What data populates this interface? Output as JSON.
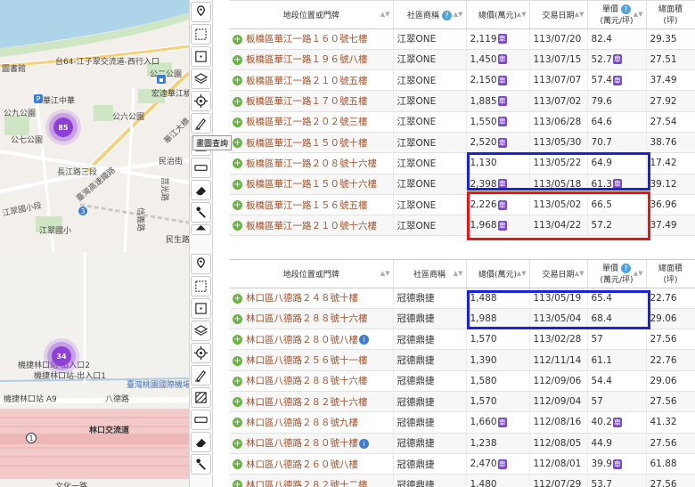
{
  "map_top": {
    "labels": [
      "台64-江子翠交流道-西行入口",
      "圖書館",
      "公二公園",
      "華江中華",
      "宏達華江橋",
      "公六公園",
      "公七公園",
      "公九公園",
      "華江大橋",
      "長江路三段",
      "臺灣高速鐵路",
      "江翠國小",
      "民治街",
      "江翠國小段",
      "莒光路",
      "信義路",
      "國道三號",
      "民生路"
    ],
    "cluster_count": "85"
  },
  "map_bottom": {
    "labels": [
      "機捷林口站-出入口2",
      "機捷林口站-出入口1",
      "機捷林口站 A9",
      "八德路",
      "臺灣桃園國際機場捷運",
      "林口交流道",
      "文化一路"
    ],
    "cluster_count": "34",
    "shield": "1"
  },
  "tools": {
    "icons": [
      "location-pin-icon",
      "select-area-icon",
      "measure-area-icon",
      "layers-icon",
      "target-icon",
      "draw-query-icon",
      "measure-icon",
      "ruler-icon",
      "eraser-icon",
      "pointer-icon",
      "house-icon"
    ],
    "tooltip": "畫圖查詢"
  },
  "table_top": {
    "headers": {
      "address": "地段位置或門牌",
      "community": "社區商稱",
      "total": "總價(萬元)",
      "date": "交易日期",
      "unit_line1": "單價",
      "unit_line2": "(萬元/坪)",
      "area_line1": "總面積",
      "area_line2": "(坪)"
    },
    "badge": "車",
    "rows": [
      {
        "address": "板橋區華江一路１６０號七樓",
        "community": "江翠ONE",
        "total": "2,119",
        "car": true,
        "date": "113/07/20",
        "unit": "82.4",
        "unit_car": false,
        "area": "29.35"
      },
      {
        "address": "板橋區華江一路１９６號八樓",
        "community": "江翠ONE",
        "total": "1,450",
        "car": true,
        "date": "113/07/15",
        "unit": "52.7",
        "unit_car": true,
        "area": "27.51"
      },
      {
        "address": "板橋區華江一路２１０號五樓",
        "community": "江翠ONE",
        "total": "2,150",
        "car": true,
        "date": "113/07/07",
        "unit": "57.4",
        "unit_car": true,
        "area": "37.49"
      },
      {
        "address": "板橋區華江一路１７０號五樓",
        "community": "江翠ONE",
        "total": "1,885",
        "car": true,
        "date": "113/07/02",
        "unit": "79.6",
        "unit_car": false,
        "area": "27.92"
      },
      {
        "address": "板橋區華江一路２０２號三樓",
        "community": "江翠ONE",
        "total": "1,550",
        "car": true,
        "date": "113/06/28",
        "unit": "64.6",
        "unit_car": false,
        "area": "27.54"
      },
      {
        "address": "板橋區華江一路１５０號十樓",
        "community": "江翠ONE",
        "total": "2,520",
        "car": true,
        "date": "113/05/30",
        "unit": "70.7",
        "unit_car": false,
        "area": "38.76"
      },
      {
        "address": "板橋區華江一路２０８號十六樓",
        "community": "江翠ONE",
        "total": "1,130",
        "car": false,
        "date": "113/05/22",
        "unit": "64.9",
        "unit_car": false,
        "area": "17.42"
      },
      {
        "address": "板橋區華江一路１５０號十六樓",
        "community": "江翠ONE",
        "total": "2,398",
        "car": true,
        "date": "113/05/18",
        "unit": "61.3",
        "unit_car": true,
        "area": "39.12"
      },
      {
        "address": "板橋區華江一路１５６號五樓",
        "community": "江翠ONE",
        "total": "2,226",
        "car": true,
        "date": "113/05/02",
        "unit": "66.5",
        "unit_car": false,
        "area": "36.96"
      },
      {
        "address": "板橋區華江一路２１０號十六樓",
        "community": "江翠ONE",
        "total": "1,968",
        "car": true,
        "date": "113/04/22",
        "unit": "57.2",
        "unit_car": false,
        "area": "37.49"
      }
    ]
  },
  "table_bottom": {
    "headers": {
      "address": "地段位置或門牌",
      "community": "社區商稱",
      "total": "總價(萬元)",
      "date": "交易日期",
      "unit_line1": "單價",
      "unit_line2": "(萬元/坪)",
      "area_line1": "總面積",
      "area_line2": "(坪)"
    },
    "badge": "車",
    "rows": [
      {
        "address": "林口區八德路２４８號十樓",
        "info": false,
        "community": "冠德鼎捷",
        "total": "1,488",
        "car": false,
        "date": "113/05/19",
        "unit": "65.4",
        "unit_car": false,
        "area": "22.76"
      },
      {
        "address": "林口區八德路２８８號十六樓",
        "info": false,
        "community": "冠德鼎捷",
        "total": "1,988",
        "car": false,
        "date": "113/05/04",
        "unit": "68.4",
        "unit_car": false,
        "area": "29.06"
      },
      {
        "address": "林口區八德路２８０號八樓",
        "info": true,
        "community": "冠德鼎捷",
        "total": "1,570",
        "car": false,
        "date": "113/02/28",
        "unit": "57",
        "unit_car": false,
        "area": "27.56"
      },
      {
        "address": "林口區八德路２５６號十一樓",
        "info": false,
        "community": "冠德鼎捷",
        "total": "1,390",
        "car": false,
        "date": "112/11/14",
        "unit": "61.1",
        "unit_car": false,
        "area": "22.76"
      },
      {
        "address": "林口區八德路２８８號十六樓",
        "info": false,
        "community": "冠德鼎捷",
        "total": "1,580",
        "car": false,
        "date": "112/09/06",
        "unit": "54.4",
        "unit_car": false,
        "area": "29.06"
      },
      {
        "address": "林口區八德路２８２號十六樓",
        "info": false,
        "community": "冠德鼎捷",
        "total": "1,570",
        "car": false,
        "date": "112/09/04",
        "unit": "57",
        "unit_car": false,
        "area": "27.56"
      },
      {
        "address": "林口區八德路２８８號九樓",
        "info": false,
        "community": "冠德鼎捷",
        "total": "1,660",
        "car": true,
        "date": "112/08/16",
        "unit": "40.2",
        "unit_car": true,
        "area": "41.32"
      },
      {
        "address": "林口區八德路２８０號十樓",
        "info": true,
        "community": "冠德鼎捷",
        "total": "1,238",
        "car": false,
        "date": "112/08/05",
        "unit": "44.9",
        "unit_car": false,
        "area": "27.56"
      },
      {
        "address": "林口區八德路２６０號八樓",
        "info": false,
        "community": "冠德鼎捷",
        "total": "2,470",
        "car": true,
        "date": "112/08/01",
        "unit": "39.9",
        "unit_car": true,
        "area": "61.88"
      },
      {
        "address": "林口區八德路２８２號十二樓",
        "info": false,
        "community": "冠德鼎捷",
        "total": "1,480",
        "car": false,
        "date": "112/07/29",
        "unit": "53.7",
        "unit_car": false,
        "area": "27.56"
      }
    ]
  },
  "highlights": {
    "blue": "#1a22e0",
    "red": "#e01919"
  }
}
